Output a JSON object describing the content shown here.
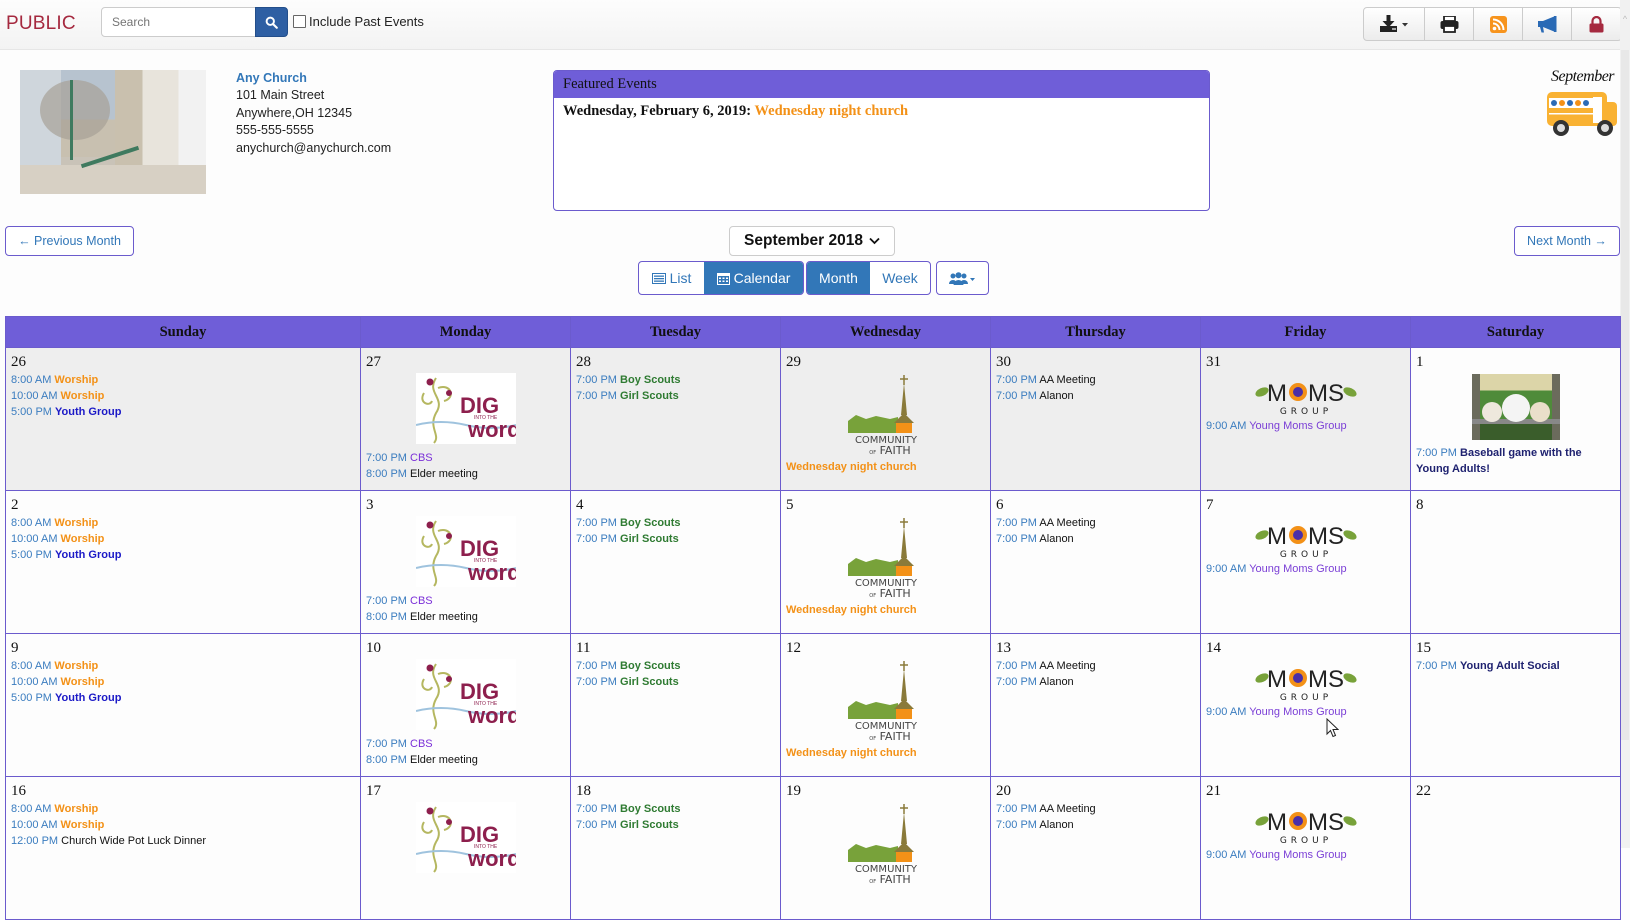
{
  "topbar": {
    "brand": "PUBLIC",
    "search_placeholder": "Search",
    "include_past_label": "Include Past Events",
    "include_past_checked": false,
    "tools": [
      {
        "icon": "download-icon",
        "has_dropdown": true
      },
      {
        "icon": "print-icon"
      },
      {
        "icon": "rss-icon",
        "color": "#f7941d"
      },
      {
        "icon": "megaphone-icon",
        "color": "#2a6ab5"
      },
      {
        "icon": "lock-icon",
        "color": "#a5293f"
      }
    ]
  },
  "church": {
    "name": "Any Church",
    "address1": "101 Main Street",
    "address2": "Anywhere,OH 12345",
    "phone": "555-555-5555",
    "email": "anychurch@anychurch.com"
  },
  "featured": {
    "title": "Featured Events",
    "items": [
      {
        "date": "Wednesday, February 6, 2019:",
        "event": "Wednesday night church"
      }
    ]
  },
  "month_graphic": {
    "label": "September"
  },
  "nav": {
    "prev_label": "← Previous Month",
    "next_label": "Next Month →",
    "current_month": "September 2018"
  },
  "views": {
    "list": "List",
    "calendar": "Calendar",
    "month": "Month",
    "week": "Week",
    "active_display": "Calendar",
    "active_range": "Month"
  },
  "colors": {
    "header_purple": "#6f5ed8",
    "link_blue": "#3277b8",
    "worship_orange": "#f39117",
    "youth_blue": "#1b19c7",
    "scouts_green": "#2f7b32",
    "brand_red": "#a5293f"
  },
  "calendar": {
    "weekdays": [
      "Sunday",
      "Monday",
      "Tuesday",
      "Wednesday",
      "Thursday",
      "Friday",
      "Saturday"
    ],
    "weeks": [
      [
        {
          "day": "26",
          "other": true,
          "events": [
            {
              "time": "8:00 AM",
              "title": "Worship",
              "type": "worship"
            },
            {
              "time": "10:00 AM",
              "title": "Worship",
              "type": "worship"
            },
            {
              "time": "5:00 PM",
              "title": "Youth Group",
              "type": "youth"
            }
          ]
        },
        {
          "day": "27",
          "other": true,
          "logo": "dig-into-the-word",
          "events": [
            {
              "time": "7:00 PM",
              "title": "CBS",
              "type": "cbs"
            },
            {
              "time": "8:00 PM",
              "title": "Elder meeting",
              "type": "plain"
            }
          ]
        },
        {
          "day": "28",
          "other": true,
          "events": [
            {
              "time": "7:00 PM",
              "title": "Boy Scouts",
              "type": "scouts"
            },
            {
              "time": "7:00 PM",
              "title": "Girl Scouts",
              "type": "scouts"
            }
          ]
        },
        {
          "day": "29",
          "other": true,
          "logo": "community-of-faith",
          "events": [
            {
              "time": "",
              "title": "Wednesday night church",
              "type": "wnc"
            }
          ]
        },
        {
          "day": "30",
          "other": true,
          "events": [
            {
              "time": "7:00 PM",
              "title": "AA Meeting",
              "type": "plain"
            },
            {
              "time": "7:00 PM",
              "title": "Alanon",
              "type": "plain"
            }
          ]
        },
        {
          "day": "31",
          "other": true,
          "logo": "moms-group",
          "events": [
            {
              "time": "9:00 AM",
              "title": "Young Moms Group",
              "type": "moms"
            }
          ]
        },
        {
          "day": "1",
          "other": false,
          "logo": "baseball",
          "events": [
            {
              "time": "7:00 PM",
              "title": "Baseball game with the Young Adults!",
              "type": "navy"
            }
          ]
        }
      ],
      [
        {
          "day": "2",
          "events": [
            {
              "time": "8:00 AM",
              "title": "Worship",
              "type": "worship"
            },
            {
              "time": "10:00 AM",
              "title": "Worship",
              "type": "worship"
            },
            {
              "time": "5:00 PM",
              "title": "Youth Group",
              "type": "youth"
            }
          ]
        },
        {
          "day": "3",
          "logo": "dig-into-the-word",
          "events": [
            {
              "time": "7:00 PM",
              "title": "CBS",
              "type": "cbs"
            },
            {
              "time": "8:00 PM",
              "title": "Elder meeting",
              "type": "plain"
            }
          ]
        },
        {
          "day": "4",
          "events": [
            {
              "time": "7:00 PM",
              "title": "Boy Scouts",
              "type": "scouts"
            },
            {
              "time": "7:00 PM",
              "title": "Girl Scouts",
              "type": "scouts"
            }
          ]
        },
        {
          "day": "5",
          "logo": "community-of-faith",
          "events": [
            {
              "time": "",
              "title": "Wednesday night church",
              "type": "wnc"
            }
          ]
        },
        {
          "day": "6",
          "events": [
            {
              "time": "7:00 PM",
              "title": "AA Meeting",
              "type": "plain"
            },
            {
              "time": "7:00 PM",
              "title": "Alanon",
              "type": "plain"
            }
          ]
        },
        {
          "day": "7",
          "logo": "moms-group",
          "events": [
            {
              "time": "9:00 AM",
              "title": "Young Moms Group",
              "type": "moms"
            }
          ]
        },
        {
          "day": "8",
          "events": []
        }
      ],
      [
        {
          "day": "9",
          "events": [
            {
              "time": "8:00 AM",
              "title": "Worship",
              "type": "worship"
            },
            {
              "time": "10:00 AM",
              "title": "Worship",
              "type": "worship"
            },
            {
              "time": "5:00 PM",
              "title": "Youth Group",
              "type": "youth"
            }
          ]
        },
        {
          "day": "10",
          "logo": "dig-into-the-word",
          "events": [
            {
              "time": "7:00 PM",
              "title": "CBS",
              "type": "cbs"
            },
            {
              "time": "8:00 PM",
              "title": "Elder meeting",
              "type": "plain"
            }
          ]
        },
        {
          "day": "11",
          "events": [
            {
              "time": "7:00 PM",
              "title": "Boy Scouts",
              "type": "scouts"
            },
            {
              "time": "7:00 PM",
              "title": "Girl Scouts",
              "type": "scouts"
            }
          ]
        },
        {
          "day": "12",
          "logo": "community-of-faith",
          "events": [
            {
              "time": "",
              "title": "Wednesday night church",
              "type": "wnc"
            }
          ]
        },
        {
          "day": "13",
          "events": [
            {
              "time": "7:00 PM",
              "title": "AA Meeting",
              "type": "plain"
            },
            {
              "time": "7:00 PM",
              "title": "Alanon",
              "type": "plain"
            }
          ]
        },
        {
          "day": "14",
          "logo": "moms-group",
          "events": [
            {
              "time": "9:00 AM",
              "title": "Young Moms Group",
              "type": "moms"
            }
          ]
        },
        {
          "day": "15",
          "events": [
            {
              "time": "7:00 PM",
              "title": "Young Adult Social",
              "type": "navy"
            }
          ]
        }
      ],
      [
        {
          "day": "16",
          "events": [
            {
              "time": "8:00 AM",
              "title": "Worship",
              "type": "worship"
            },
            {
              "time": "10:00 AM",
              "title": "Worship",
              "type": "worship"
            },
            {
              "time": "12:00 PM",
              "title": "Church Wide Pot Luck Dinner",
              "type": "plain"
            }
          ]
        },
        {
          "day": "17",
          "logo": "dig-into-the-word",
          "events": []
        },
        {
          "day": "18",
          "events": [
            {
              "time": "7:00 PM",
              "title": "Boy Scouts",
              "type": "scouts"
            },
            {
              "time": "7:00 PM",
              "title": "Girl Scouts",
              "type": "scouts"
            }
          ]
        },
        {
          "day": "19",
          "logo": "community-of-faith",
          "events": []
        },
        {
          "day": "20",
          "events": [
            {
              "time": "7:00 PM",
              "title": "AA Meeting",
              "type": "plain"
            },
            {
              "time": "7:00 PM",
              "title": "Alanon",
              "type": "plain"
            }
          ]
        },
        {
          "day": "21",
          "logo": "moms-group",
          "events": [
            {
              "time": "9:00 AM",
              "title": "Young Moms Group",
              "type": "moms"
            }
          ]
        },
        {
          "day": "22",
          "events": []
        }
      ]
    ]
  }
}
